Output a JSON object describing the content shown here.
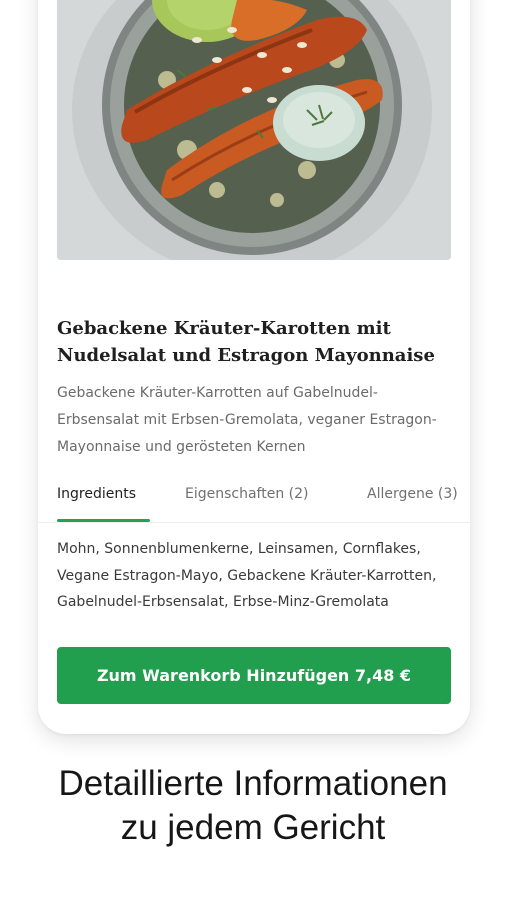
{
  "dish": {
    "title": "Gebackene Kräuter-Karotten mit Nudelsalat und Estragon Mayonnaise",
    "description": "Gebackene Kräuter-Karrotten auf Gabelnudel-Erbsensalat mit Erbsen-Gremolata, veganer Estragon-Mayonnaise und gerösteten Kernen",
    "image_icon": "food-bowl-photo"
  },
  "tabs": [
    {
      "label": "Ingredients",
      "active": true
    },
    {
      "label": "Eigenschaften (2)",
      "active": false
    },
    {
      "label": "Allergene (3)",
      "active": false
    }
  ],
  "ingredients_text": "Mohn, Sonnenblumenkerne, Leinsamen, Cornflakes, Vegane Estragon-Mayo, Gebackene Kräuter-Karrotten, Gabelnudel-Erbsensalat, Erbse-Minz-Gremolata",
  "cart_button": {
    "label": "Zum Warenkorb Hinzufügen 7,48 €"
  },
  "headline": {
    "line1": "Detaillierte Informationen",
    "line2": "zu jedem Gericht"
  },
  "colors": {
    "accent": "#229e4f",
    "tab_underline": "#2e9c57",
    "text_dark": "#1f1f1f",
    "text_muted": "#6b6b6b"
  }
}
